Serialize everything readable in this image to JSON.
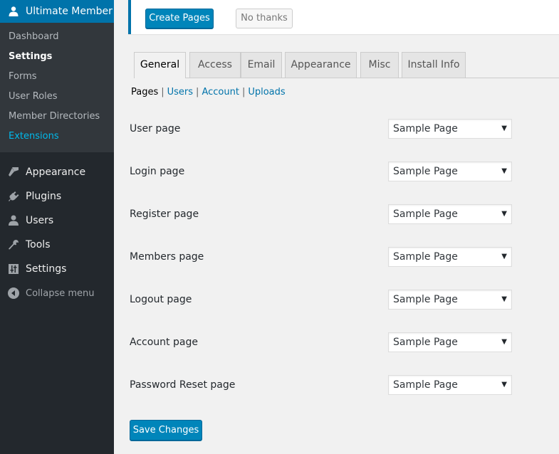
{
  "sidebar": {
    "plugin_title": "Ultimate Member",
    "submenu": [
      {
        "label": "Dashboard",
        "state": "normal"
      },
      {
        "label": "Settings",
        "state": "current"
      },
      {
        "label": "Forms",
        "state": "normal"
      },
      {
        "label": "User Roles",
        "state": "normal"
      },
      {
        "label": "Member Directories",
        "state": "normal"
      },
      {
        "label": "Extensions",
        "state": "highlight"
      }
    ],
    "menu": [
      {
        "label": "Appearance",
        "icon": "paintbrush-icon"
      },
      {
        "label": "Plugins",
        "icon": "plug-icon"
      },
      {
        "label": "Users",
        "icon": "user-icon"
      },
      {
        "label": "Tools",
        "icon": "wrench-icon"
      },
      {
        "label": "Settings",
        "icon": "sliders-icon"
      },
      {
        "label": "Collapse menu",
        "icon": "collapse-icon"
      }
    ]
  },
  "notice": {
    "create_label": "Create Pages",
    "dismiss_label": "No thanks"
  },
  "tabs": [
    {
      "label": "General",
      "active": true
    },
    {
      "label": "Access",
      "active": false
    },
    {
      "label": "Email",
      "active": false
    },
    {
      "label": "Appearance",
      "active": false
    },
    {
      "label": "Misc",
      "active": false
    },
    {
      "label": "Install Info",
      "active": false
    }
  ],
  "subnav": {
    "current": "Pages",
    "links": [
      "Users",
      "Account",
      "Uploads"
    ],
    "separator": "|"
  },
  "fields": [
    {
      "label": "User page",
      "value": "Sample Page"
    },
    {
      "label": "Login page",
      "value": "Sample Page"
    },
    {
      "label": "Register page",
      "value": "Sample Page"
    },
    {
      "label": "Members page",
      "value": "Sample Page"
    },
    {
      "label": "Logout page",
      "value": "Sample Page"
    },
    {
      "label": "Account page",
      "value": "Sample Page"
    },
    {
      "label": "Password Reset page",
      "value": "Sample Page"
    }
  ],
  "dropdown_arrow": "▼",
  "save_label": "Save Changes",
  "colors": {
    "accent": "#0073aa",
    "primary_button": "#0085ba",
    "sidebar_bg": "#23282d",
    "submenu_bg": "#32373c",
    "highlight_link": "#00b9eb"
  }
}
